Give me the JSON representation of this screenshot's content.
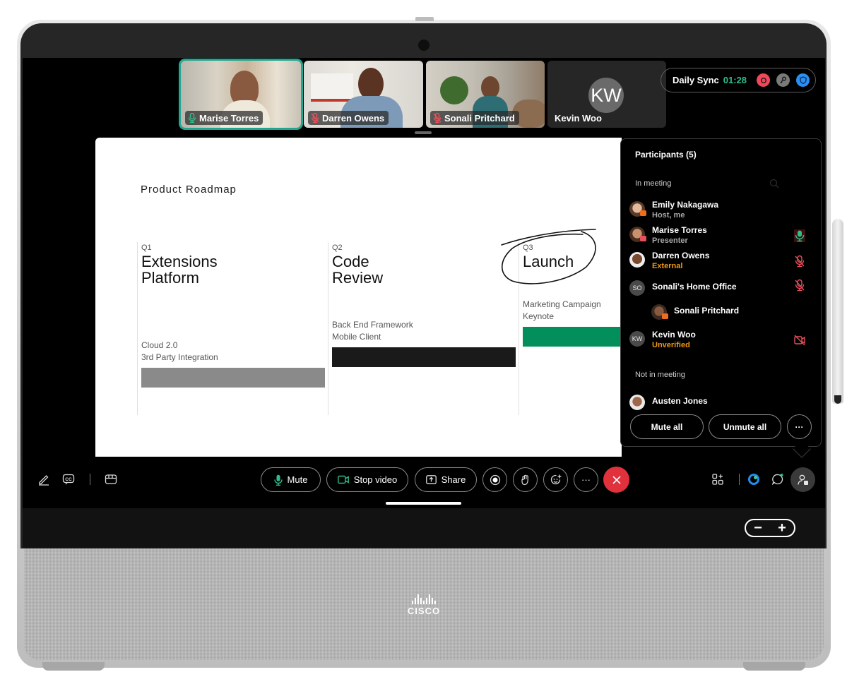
{
  "meeting": {
    "title": "Daily Sync",
    "elapsed": "01:28",
    "indicators": [
      {
        "name": "recording-icon",
        "color": "#f0485a"
      },
      {
        "name": "key-icon",
        "color": "#7a7a7a"
      },
      {
        "name": "shield-icon",
        "color": "#2b8ff2"
      }
    ]
  },
  "video_strip": {
    "tiles": [
      {
        "name": "Marise Torres",
        "mic": "active",
        "active_speaker": true
      },
      {
        "name": "Darren Owens",
        "mic": "muted"
      },
      {
        "name": "Sonali Pritchard",
        "mic": "muted"
      },
      {
        "name": "Kevin Woo",
        "initials": "KW",
        "video": "off"
      }
    ]
  },
  "slide": {
    "title": "Product Roadmap",
    "columns": [
      {
        "quarter": "Q1",
        "heading_line1": "Extensions",
        "heading_line2": "Platform",
        "items": [
          "Cloud 2.0",
          "3rd Party Integration"
        ],
        "bar_color": "#8a8a8a"
      },
      {
        "quarter": "Q2",
        "heading_line1": "Code",
        "heading_line2": "Review",
        "items": [
          "Back End Framework",
          "Mobile Client"
        ],
        "bar_color": "#1a1a1a"
      },
      {
        "quarter": "Q3",
        "heading_line1": "Launch",
        "heading_line2": "",
        "items": [
          "Marketing Campaign",
          "Keynote"
        ],
        "bar_color": "#038f5c"
      }
    ]
  },
  "participants_panel": {
    "title": "Participants (5)",
    "in_meeting_label": "In meeting",
    "not_in_meeting_label": "Not in meeting",
    "in_meeting": [
      {
        "name": "Emily Nakagawa",
        "subtitle": "Host, me",
        "subtitle_style": "grey",
        "status": "none"
      },
      {
        "name": "Marise Torres",
        "subtitle": "Presenter",
        "subtitle_style": "grey",
        "status": "mic-active"
      },
      {
        "name": "Darren Owens",
        "subtitle": "External",
        "subtitle_style": "orange",
        "status": "mic-muted"
      },
      {
        "name": "Sonali's Home Office",
        "initials": "SO",
        "subtitle": "",
        "status": "mic-muted"
      },
      {
        "name": "Sonali Pritchard",
        "subtitle": "",
        "status": "none",
        "nested": true
      },
      {
        "name": "Kevin Woo",
        "initials": "KW",
        "subtitle": "Unverified",
        "subtitle_style": "orange",
        "status": "video-off"
      }
    ],
    "not_in_meeting": [
      {
        "name": "Austen Jones"
      }
    ],
    "buttons": {
      "mute_all": "Mute all",
      "unmute_all": "Unmute all",
      "more": "···"
    }
  },
  "controls": {
    "mute": "Mute",
    "stop_video": "Stop video",
    "share": "Share",
    "more": "···"
  },
  "device": {
    "brand": "CISCO"
  },
  "colors": {
    "accent_green": "#2fbd8a",
    "active_speaker_border": "#23a690",
    "end_call": "#e0313c",
    "warning_orange": "#f09a12",
    "muted_red": "#e8505b"
  }
}
